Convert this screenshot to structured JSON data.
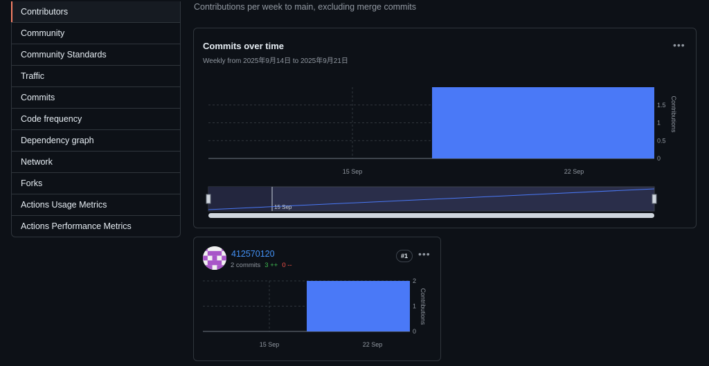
{
  "sidebar": {
    "items": [
      {
        "label": "Contributors",
        "active": true
      },
      {
        "label": "Community"
      },
      {
        "label": "Community Standards"
      },
      {
        "label": "Traffic"
      },
      {
        "label": "Commits"
      },
      {
        "label": "Code frequency"
      },
      {
        "label": "Dependency graph"
      },
      {
        "label": "Network"
      },
      {
        "label": "Forks"
      },
      {
        "label": "Actions Usage Metrics"
      },
      {
        "label": "Actions Performance Metrics"
      }
    ]
  },
  "page": {
    "subtitle": "Contributions per week to main, excluding merge commits"
  },
  "main_chart": {
    "title": "Commits over time",
    "subtitle": "Weekly from 2025年9月14日 to 2025年9月21日",
    "menu_icon": "kebab-horizontal-icon",
    "navigator_label": "15 Sep"
  },
  "contributor": {
    "name": "412570120",
    "commits": "2 commits",
    "additions": "3 ++",
    "deletions": "0 --",
    "rank": "#1",
    "menu_icon": "kebab-horizontal-icon"
  },
  "colors": {
    "bar": "#4a79f7",
    "accent": "#f78166",
    "link": "#4493f8"
  },
  "chart_data": [
    {
      "type": "bar",
      "title": "Commits over time",
      "x_ticks": [
        "15 Sep",
        "22 Sep"
      ],
      "ylabel": "Contributions",
      "y_ticks": [
        "0",
        "0.5",
        "1",
        "1.5"
      ],
      "ylim": [
        0,
        2
      ],
      "bars": [
        {
          "start": "15 Sep",
          "end": "22 Sep",
          "value": 2
        }
      ],
      "grid": true
    },
    {
      "type": "bar",
      "x_ticks": [
        "15 Sep",
        "22 Sep"
      ],
      "ylabel": "Contributions",
      "y_ticks": [
        "0",
        "1",
        "2"
      ],
      "ylim": [
        0,
        2
      ],
      "bars": [
        {
          "start": "15 Sep",
          "end": "22 Sep",
          "value": 2
        }
      ],
      "grid": true
    }
  ]
}
